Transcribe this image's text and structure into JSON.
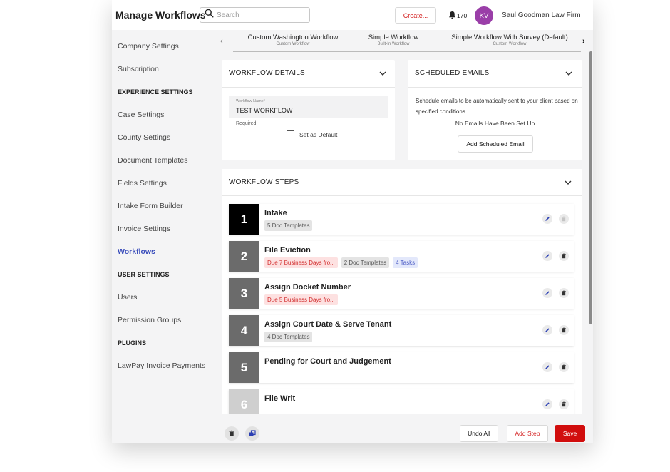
{
  "header": {
    "title": "Manage Workflows",
    "search_placeholder": "Search",
    "create_label": "Create...",
    "notification_count": "170",
    "avatar_initials": "KV",
    "firm_name": "Saul Goodman Law Firm",
    "colors": {
      "avatar": "#9a3ea8",
      "create_text": "#d42020"
    }
  },
  "sidebar": {
    "items": [
      {
        "label": "Company Settings",
        "type": "item"
      },
      {
        "label": "Subscription",
        "type": "item"
      },
      {
        "label": "EXPERIENCE SETTINGS",
        "type": "heading"
      },
      {
        "label": "Case Settings",
        "type": "item"
      },
      {
        "label": "County Settings",
        "type": "item"
      },
      {
        "label": "Document Templates",
        "type": "item"
      },
      {
        "label": "Fields Settings",
        "type": "item"
      },
      {
        "label": "Intake Form Builder",
        "type": "item"
      },
      {
        "label": "Invoice Settings",
        "type": "item"
      },
      {
        "label": "Workflows",
        "type": "active"
      },
      {
        "label": "USER SETTINGS",
        "type": "heading"
      },
      {
        "label": "Users",
        "type": "item"
      },
      {
        "label": "Permission Groups",
        "type": "item"
      },
      {
        "label": "PLUGINS",
        "type": "heading"
      },
      {
        "label": "LawPay Invoice Payments",
        "type": "item"
      }
    ],
    "active_color": "#3a4dbb"
  },
  "tabs": [
    {
      "title": "Custom Washington Workflow",
      "subtitle": "Custom Workflow"
    },
    {
      "title": "Simple Workflow",
      "subtitle": "Built-In Workflow"
    },
    {
      "title": "Simple Workflow With Survey  (Default)",
      "subtitle": "Custom Workflow"
    }
  ],
  "workflow_details": {
    "heading": "WORKFLOW DETAILS",
    "name_label": "Workflow Name*",
    "name_value": "TEST WORKFLOW",
    "required_text": "Required",
    "default_label": "Set as Default",
    "default_checked": false
  },
  "scheduled_emails": {
    "heading": "SCHEDULED EMAILS",
    "description": "Schedule emails to be automatically sent to your client based on specified conditions.",
    "empty_text": "No Emails Have Been Set Up",
    "add_label": "Add Scheduled Email"
  },
  "workflow_steps": {
    "heading": "WORKFLOW STEPS",
    "steps": [
      {
        "number": "1",
        "title": "Intake",
        "chips": [
          {
            "text": "5 Doc Templates",
            "kind": "doc"
          }
        ]
      },
      {
        "number": "2",
        "title": "File Eviction",
        "chips": [
          {
            "text": "Due 7 Business Days fro...",
            "kind": "due"
          },
          {
            "text": "2 Doc Templates",
            "kind": "doc"
          },
          {
            "text": "4 Tasks",
            "kind": "task"
          }
        ]
      },
      {
        "number": "3",
        "title": "Assign Docket Number",
        "chips": [
          {
            "text": "Due 5 Business Days fro...",
            "kind": "due"
          }
        ]
      },
      {
        "number": "4",
        "title": "Assign Court Date & Serve Tenant",
        "chips": [
          {
            "text": "4 Doc Templates",
            "kind": "doc"
          }
        ]
      },
      {
        "number": "5",
        "title": "Pending for Court and Judgement",
        "chips": []
      },
      {
        "number": "6",
        "title": "File Writ",
        "chips": []
      }
    ]
  },
  "footer": {
    "undo_label": "Undo All",
    "add_step_label": "Add Step",
    "save_label": "Save",
    "colors": {
      "save_bg": "#d10d0d",
      "add_step_text": "#d42020"
    }
  }
}
